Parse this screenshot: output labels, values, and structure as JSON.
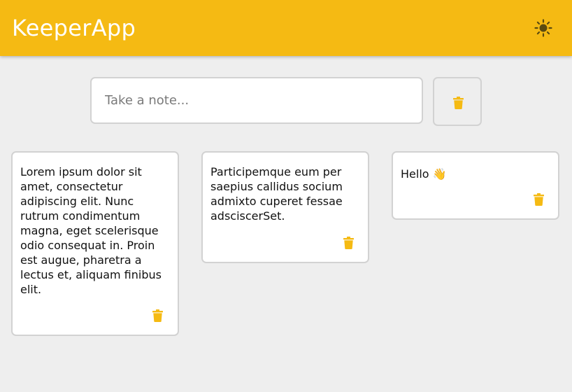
{
  "app": {
    "title": "KeeperApp",
    "accent_color": "#f5ba13",
    "background_color": "#eeeeee",
    "theme_icon": "sun-icon"
  },
  "composer": {
    "placeholder": "Take a note...",
    "value": "",
    "clear_icon": "trash-icon"
  },
  "notes": [
    {
      "text": "Lorem ipsum dolor sit amet, consectetur adipiscing elit. Nunc rutrum condimentum magna, eget scelerisque odio consequat in. Proin est augue, pharetra a lectus et, aliquam finibus elit.",
      "delete_icon": "trash-icon"
    },
    {
      "text": "Participemque eum per saepius callidus socium admixto cuperet fessae adsciscerSet.",
      "delete_icon": "trash-icon"
    },
    {
      "text": "Hello 👋",
      "delete_icon": "trash-icon"
    }
  ]
}
